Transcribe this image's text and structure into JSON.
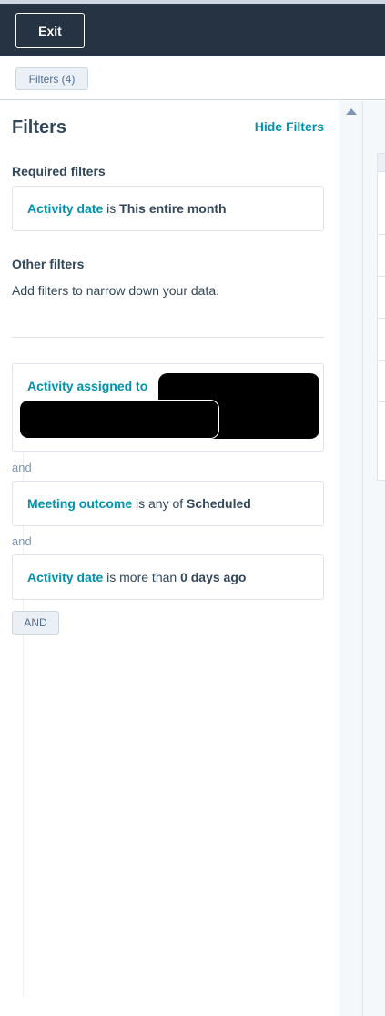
{
  "topbar": {
    "exit_label": "Exit"
  },
  "subbar": {
    "filters_chip": "Filters (4)"
  },
  "panel": {
    "title": "Filters",
    "hide_label": "Hide Filters",
    "required_label": "Required filters",
    "required_filter": {
      "property": "Activity date",
      "operator": "is",
      "value": "This entire month"
    },
    "other_label": "Other filters",
    "other_help": "Add filters to narrow down your data.",
    "filters": [
      {
        "property": "Activity assigned to",
        "operator": "",
        "value": ""
      },
      {
        "property": "Meeting outcome",
        "operator": "is any of",
        "value": "Scheduled"
      },
      {
        "property": "Activity date",
        "operator": "is more than",
        "value": "0 days ago"
      }
    ],
    "joiner": "and",
    "and_button": "AND"
  },
  "colors": {
    "topbar_bg": "#253342",
    "accent": "#0091ae",
    "text": "#33475b",
    "border": "#dfe3eb"
  }
}
